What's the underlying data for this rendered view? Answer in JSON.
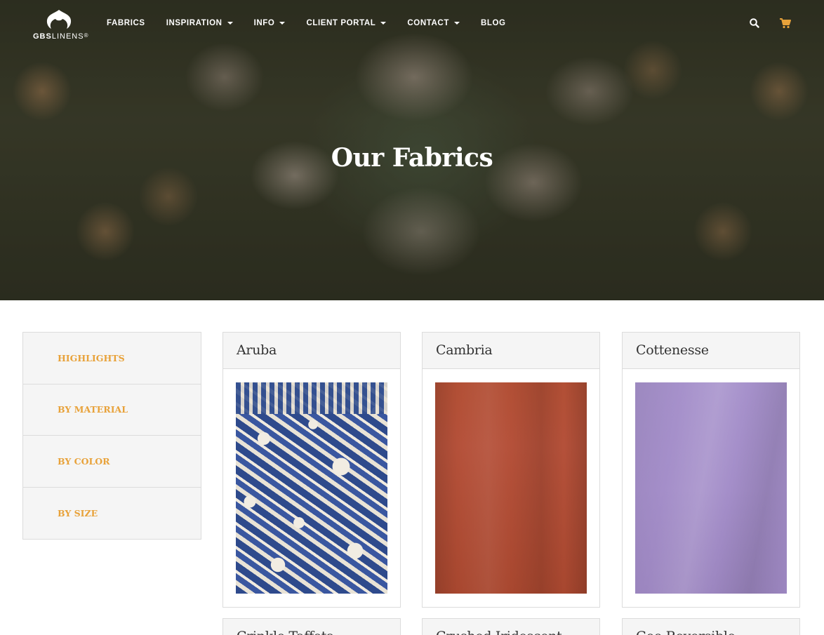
{
  "header": {
    "logo": {
      "brand_bold": "GBS",
      "brand_light": "LINENS",
      "registered": "®"
    },
    "nav": [
      {
        "label": "FABRICS",
        "has_dropdown": false
      },
      {
        "label": "INSPIRATION",
        "has_dropdown": true
      },
      {
        "label": "INFO",
        "has_dropdown": true
      },
      {
        "label": "CLIENT PORTAL",
        "has_dropdown": true
      },
      {
        "label": "CONTACT",
        "has_dropdown": true
      },
      {
        "label": "BLOG",
        "has_dropdown": false
      }
    ],
    "icons": {
      "search": "search-icon",
      "cart": "cart-icon"
    },
    "cart_color": "#e8a23a"
  },
  "hero": {
    "title": "Our Fabrics"
  },
  "sidebar": {
    "items": [
      {
        "label": "HIGHLIGHTS"
      },
      {
        "label": "BY MATERIAL"
      },
      {
        "label": "BY COLOR"
      },
      {
        "label": "BY SIZE"
      }
    ],
    "accent_color": "#e8a23a"
  },
  "products": [
    {
      "name": "Aruba"
    },
    {
      "name": "Cambria"
    },
    {
      "name": "Cottenesse"
    },
    {
      "name": "Crinkle Taffeta"
    },
    {
      "name": "Crushed Iridescent Satin"
    },
    {
      "name": "Geo Reversible"
    }
  ]
}
